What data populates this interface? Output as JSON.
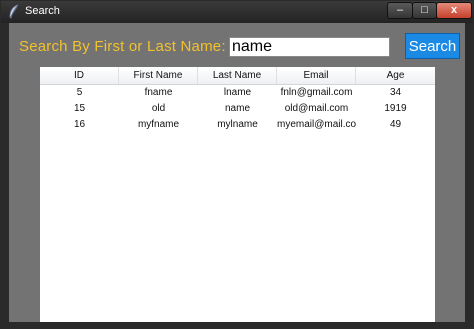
{
  "window": {
    "title": "Search",
    "controls": {
      "minimize": "–",
      "maximize": "□",
      "close": "x"
    }
  },
  "search": {
    "label": "Search By First or Last Name:",
    "value": "name",
    "button": "Search"
  },
  "table": {
    "columns": [
      "ID",
      "First Name",
      "Last Name",
      "Email",
      "Age"
    ],
    "rows": [
      [
        "5",
        "fname",
        "lname",
        "fnln@gmail.com",
        "34"
      ],
      [
        "15",
        "old",
        "name",
        "old@mail.com",
        "1919"
      ],
      [
        "16",
        "myfname",
        "mylname",
        "myemail@mail.com",
        "49"
      ]
    ]
  },
  "colors": {
    "label": "#f2c12e",
    "button": "#1a8ae5",
    "client": "#737373",
    "frame": "#2a2a2a"
  },
  "icons": {
    "app": "feather-icon"
  }
}
